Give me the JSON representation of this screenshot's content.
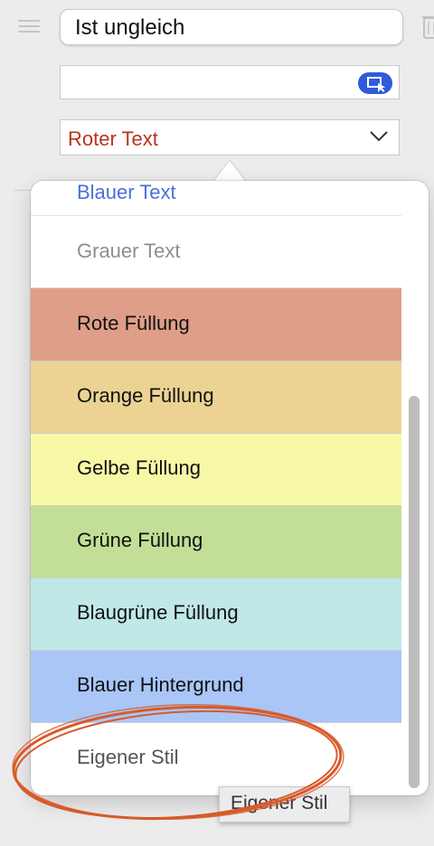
{
  "rule": {
    "condition": "Ist ungleich",
    "value": "",
    "selected_style": "Roter Text"
  },
  "popover": {
    "options": [
      {
        "label": "Blauer Text",
        "text_color": "#4a70d9"
      },
      {
        "label": "Grauer Text",
        "text_color": "#8e8e8e"
      },
      {
        "label": "Rote Füllung",
        "fill": "#df9e88"
      },
      {
        "label": "Orange Füllung",
        "fill": "#ecd394"
      },
      {
        "label": "Gelbe Füllung",
        "fill": "#f7f8a6"
      },
      {
        "label": "Grüne Füllung",
        "fill": "#c3df97"
      },
      {
        "label": "Blaugrüne Füllung",
        "fill": "#bfe8e6"
      },
      {
        "label": "Blauer Hintergrund",
        "fill": "#a9c6f7"
      },
      {
        "label": "Eigener Stil",
        "text_color": "#555555"
      }
    ]
  },
  "tooltip": {
    "text": "Eigener Stil"
  },
  "colors": {
    "accent": "#2e5bdc",
    "selected_text": "#b8341f",
    "annotation": "#d85a2a"
  },
  "icons": {
    "drag": "drag-handle-icon",
    "delete": "trash-icon",
    "pick": "picker-icon",
    "dropdown": "chevron-down-icon"
  }
}
